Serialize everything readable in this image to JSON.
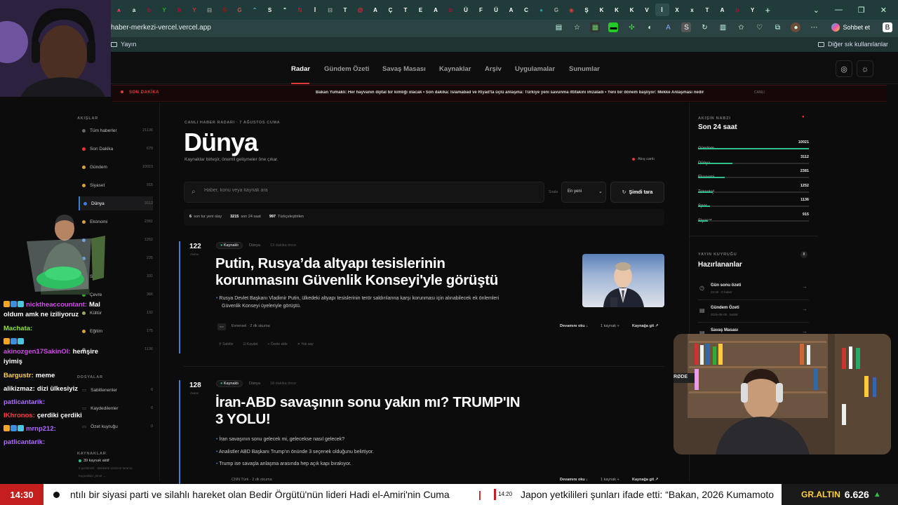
{
  "browser": {
    "url": "haber-merkezi-vercel.vercel.app",
    "tabs": [
      {
        "g": "ʌ",
        "c": "#ff4d6d"
      },
      {
        "g": "a",
        "c": "#f0f0f0"
      },
      {
        "g": "b",
        "c": "#c03"
      },
      {
        "g": "Y",
        "c": "#3a3"
      },
      {
        "g": "b",
        "c": "#c03"
      },
      {
        "g": "Y",
        "c": "#c33"
      },
      {
        "g": "⊟",
        "c": "#aaa"
      },
      {
        "g": "S",
        "c": "#c00"
      },
      {
        "g": "G",
        "c": "#e44"
      },
      {
        "g": "⌃",
        "c": "#6cf"
      },
      {
        "g": "S",
        "c": "#fff"
      },
      {
        "g": "\"",
        "c": "#fff"
      },
      {
        "g": "N",
        "c": "#e50914"
      },
      {
        "g": "İ",
        "c": "#fff"
      },
      {
        "g": "⊟",
        "c": "#aaa"
      },
      {
        "g": "T",
        "c": "#fff"
      },
      {
        "g": "@",
        "c": "#e33"
      },
      {
        "g": "A",
        "c": "#fff"
      },
      {
        "g": "Ç",
        "c": "#fff"
      },
      {
        "g": "T",
        "c": "#fff"
      },
      {
        "g": "E",
        "c": "#fff"
      },
      {
        "g": "A",
        "c": "#fff"
      },
      {
        "g": "b",
        "c": "#c03"
      },
      {
        "g": "Ü",
        "c": "#fff"
      },
      {
        "g": "F",
        "c": "#fff"
      },
      {
        "g": "Ü",
        "c": "#fff"
      },
      {
        "g": "A",
        "c": "#fff"
      },
      {
        "g": "C",
        "c": "#fff"
      },
      {
        "g": "●",
        "c": "#29a"
      },
      {
        "g": "G",
        "c": "#aaa"
      },
      {
        "g": "◉",
        "c": "#e33"
      },
      {
        "g": "Ş",
        "c": "#fff"
      },
      {
        "g": "K",
        "c": "#fff"
      },
      {
        "g": "K",
        "c": "#fff"
      },
      {
        "g": "K",
        "c": "#fff"
      },
      {
        "g": "V",
        "c": "#fff"
      },
      {
        "g": "İ",
        "c": "#fff"
      },
      {
        "g": "X",
        "c": "#fff"
      },
      {
        "g": "x",
        "c": "#fff"
      },
      {
        "g": "T",
        "c": "#fff"
      },
      {
        "g": "A",
        "c": "#fff"
      },
      {
        "g": "b",
        "c": "#c03"
      },
      {
        "g": "Y",
        "c": "#fff"
      }
    ],
    "bookmark": "Yayın",
    "other_bookmarks": "Diğer sık kullanılanlar",
    "chat_button": "Sohbet et"
  },
  "nav": {
    "items": [
      "Radar",
      "Gündem Özeti",
      "Savaş Masası",
      "Kaynaklar",
      "Arşiv",
      "Uygulamalar",
      "Sunumlar"
    ],
    "active": 0
  },
  "breaking": {
    "label": "SON DAKİKA",
    "text": "Bakan Yumaklı: Her hayvanın dijital bir kimliği olacak • Son dakika: İslamabad ve Riyad'ta üçlü anlaşma: Türkiye yeni savunma ittifakını imzaladı • Yeni bir dönem başlıyor: Mekke Anlaşması nedir",
    "status": "CANLI"
  },
  "sidebar": {
    "heading": "AKIŞLAR",
    "items": [
      {
        "label": "Tüm haberler",
        "count": "21136",
        "color": "#666"
      },
      {
        "label": "Son Dakika",
        "count": "679",
        "color": "#e33"
      },
      {
        "label": "Gündem",
        "count": "10023",
        "color": "#d9a23a"
      },
      {
        "label": "Siyaset",
        "count": "915",
        "color": "#d9a23a"
      },
      {
        "label": "Dünya",
        "count": "3112",
        "color": "#3b7dd8"
      },
      {
        "label": "Ekonomi",
        "count": "2381",
        "color": "#d9a23a"
      },
      {
        "label": "",
        "count": "1252",
        "color": "#3b7dd8"
      },
      {
        "label": "",
        "count": "235",
        "color": "#3b7dd8"
      },
      {
        "label": "Sağlık",
        "count": "331",
        "color": "#c33"
      },
      {
        "label": "Çevre",
        "count": "366",
        "color": "#3a3"
      },
      {
        "label": "Kültür",
        "count": "132",
        "color": "#9a6"
      },
      {
        "label": "Eğitim",
        "count": "175",
        "color": "#d9a23a"
      },
      {
        "label": "",
        "count": "1136",
        "color": "#666"
      }
    ],
    "files_heading": "DOSYALAR",
    "files": [
      {
        "label": "Sabitlenenler",
        "count": "0"
      },
      {
        "label": "Kaydedilenler",
        "count": "0"
      },
      {
        "label": "Özet kuyruğu",
        "count": "0"
      }
    ],
    "sources_heading": "KAYNAKLAR",
    "sources_active": "39 kaynak aktif",
    "sources_sub": "0 gecikmeli · dakikalık senkron tarama",
    "sources_link": "Kaynakları yönet →"
  },
  "main": {
    "kicker": "CANLI HABER RADARI · 7 AĞUSTOS CUMA",
    "title": "Dünya",
    "subtitle": "Kaynaklar birleşir, önemli gelişmeler öne çıkar.",
    "live": "Akış canlı",
    "search_placeholder": "Haber, konu veya kaynak ara",
    "sort_label": "Sırala",
    "sort_value": "En yeni",
    "refresh": "Şimdi tara",
    "stats": [
      {
        "num": "6",
        "txt": "son tur yeni olay"
      },
      {
        "num": "3215",
        "txt": "son 24 saat"
      },
      {
        "num": "997",
        "txt": "Türkçeleştirilen"
      }
    ],
    "articles": [
      {
        "score": "122",
        "score_lab": "ÖNEM",
        "badge": "Kaynaklı",
        "cat": "Dünya",
        "time": "13 dakika önce",
        "title1": "Putin, Rusya’da altyapı tesislerinin",
        "title2": "korunmasını Güvenlik Konseyi'yle görüştü",
        "bullets": [
          "Rusya Devlet Başkanı Vladimir Putin, ülkedeki altyapı tesislerinin terör saldırılarına karşı korunması için alınabilecek ek önlemleri",
          "Güvenlik Konseyi üyeleriyle görüştü."
        ],
        "source": "Evrensel · 2 dk okuma",
        "more": "Devamını oku ↓",
        "srccount": "1 kaynak +",
        "goto": "Kaynağa git ↗",
        "actions": [
          "Sabitle",
          "Kaydet",
          "Özete ekle",
          "Yok say"
        ]
      },
      {
        "score": "128",
        "score_lab": "ÖNEM",
        "badge": "Kaynaklı",
        "cat": "Dünya",
        "time": "18 dakika önce",
        "title1": "İran-ABD savaşının sonu yakın mı? TRUMP'IN",
        "title2": "3 YOLU!",
        "bullets": [
          "İran savaşının sonu gelecek mi, gelecekse nasıl gelecek?",
          "Analistler ABD Başkanı Trump'ın önünde 3 seçenek olduğunu belirtiyor.",
          "Trump ise savaşla anlaşma arasında hep açık kapı bırakıyor."
        ],
        "source": "CNN Türk · 2 dk okuma",
        "more": "Devamını oku ↓",
        "srccount": "1 kaynak +",
        "goto": "Kaynağa git ↗"
      }
    ]
  },
  "right": {
    "heading": "AKIŞIN NABZI",
    "title": "Son 24 saat",
    "stats": [
      {
        "label": "Gündem",
        "value": "10021",
        "frac": 1.0
      },
      {
        "label": "Dünya",
        "value": "3112",
        "frac": 0.31
      },
      {
        "label": "Ekonomi",
        "value": "2381",
        "frac": 0.24
      },
      {
        "label": "Teknoloji",
        "value": "1252",
        "frac": 0.13
      },
      {
        "label": "Spor",
        "value": "1136",
        "frac": 0.11
      },
      {
        "label": "Siyaset",
        "value": "915",
        "frac": 0.09
      }
    ],
    "queue_heading": "YAYIN KUYRUĞU",
    "queue_count": "8",
    "queue_title": "Hazırlananlar",
    "queue": [
      {
        "label": "Gün sonu özeti",
        "sub": "23:30 · 0 haber"
      },
      {
        "label": "Gündem Özeti",
        "sub": "2026-08-08 · taslak"
      },
      {
        "label": "Savaş Masası",
        "sub": ""
      }
    ]
  },
  "chat": {
    "lines": [
      {
        "user": "nicktheaccountant:",
        "msg": "Mal",
        "color": "#d04be8",
        "badges": true
      },
      {
        "user": "",
        "msg": "oldum amk ne iziliyoruz",
        "color": "#fff"
      },
      {
        "user": "Machata:",
        "msg": "",
        "color": "#8de33a"
      },
      {
        "user": "",
        "msg": "",
        "color": "#fff",
        "badges": true
      },
      {
        "user": "akinozgen17SakinOl:",
        "msg": "hemşire",
        "color": "#d04be8"
      },
      {
        "user": "",
        "msg": "iyimiş",
        "color": "#fff"
      },
      {
        "user": "Bargustr:",
        "msg": "meme",
        "color": "#ffd34d"
      },
      {
        "user": "alikizmaz:",
        "msg": "dizi ülkesiyiz",
        "color": "#fff"
      },
      {
        "user": "patlicantarik:",
        "msg": "",
        "color": "#b06bff"
      },
      {
        "user": "IKhronos:",
        "msg": "çerdiki çerdiki",
        "color": "#ff3a3a"
      },
      {
        "user": "mrnp212:",
        "msg": "",
        "color": "#b06bff",
        "badges": true
      },
      {
        "user": "patlicantarik:",
        "msg": "",
        "color": "#b06bff"
      }
    ]
  },
  "ticker": {
    "time": "14:30",
    "text1": "ntılı bir siyasi parti ve silahlı hareket olan Bedir Örgütü'nün lideri Hadi el-Amiri'nin Cuma",
    "sep": "|",
    "time2": "14:20",
    "text2": "Japon yetkilileri şunları ifade etti: “Bakan, 2026 Kumamoto",
    "market_label": "GR.ALTIN",
    "market_value": "6.626",
    "market_arrow": "▲"
  },
  "colors": {
    "accent": "#e03a3a",
    "green": "#2fbf8a",
    "blue": "#3b7dd8"
  }
}
